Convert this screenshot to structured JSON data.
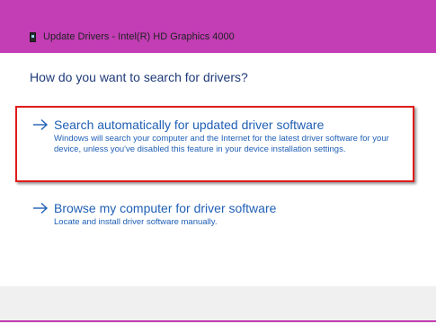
{
  "window": {
    "title": "Update Drivers - Intel(R) HD Graphics 4000",
    "title_icon": "device-manager-icon",
    "accent_color": "#c33db5"
  },
  "dialog": {
    "heading": "How do you want to search for drivers?",
    "options": [
      {
        "title": "Search automatically for updated driver software",
        "description": "Windows will search your computer and the Internet for the latest driver software for your device, unless you've disabled this feature in your device installation settings.",
        "icon": "arrow-right-icon",
        "highlighted": true
      },
      {
        "title": "Browse my computer for driver software",
        "description": "Locate and install driver software manually.",
        "icon": "arrow-right-icon",
        "highlighted": false
      }
    ],
    "link_color": "#1f5fb5",
    "highlight_color": "#e01b1b"
  }
}
